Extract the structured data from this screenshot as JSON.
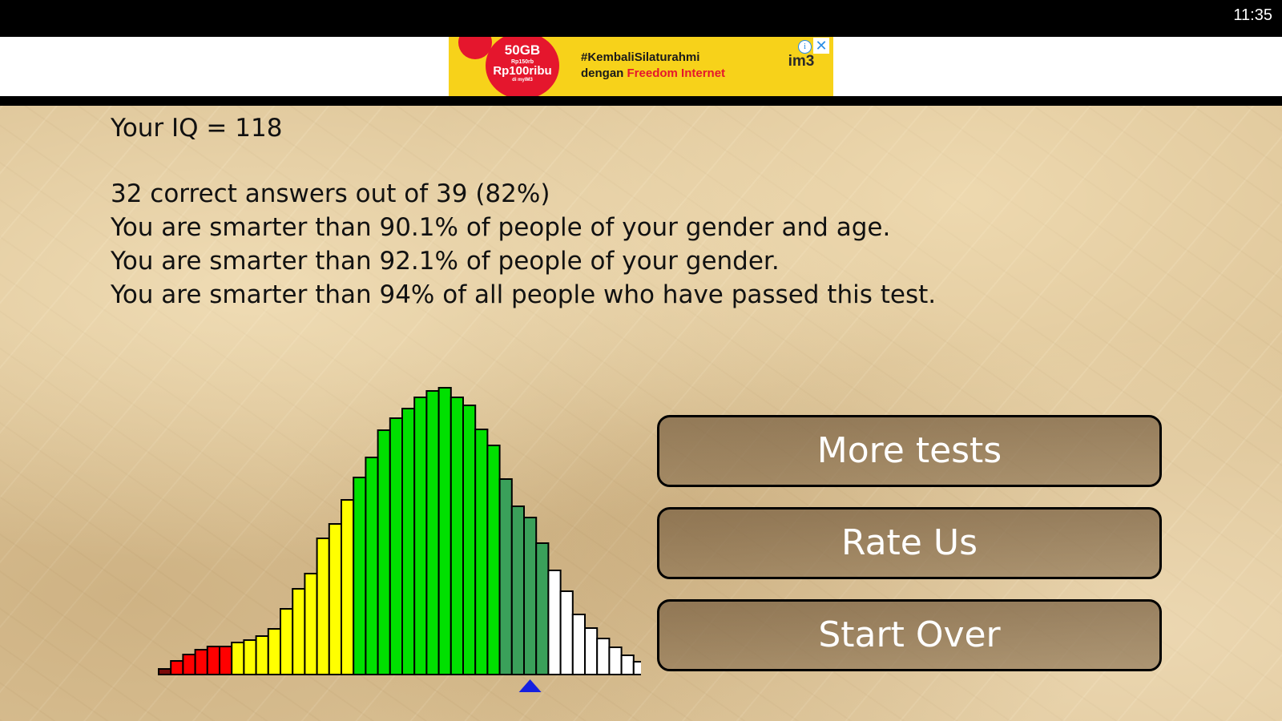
{
  "status_bar": {
    "time": "11:35"
  },
  "ad": {
    "data_amount": "50GB",
    "price_small": "Rp150rb",
    "price": "Rp100ribu",
    "price_sub": "di myIM3",
    "hashtag": "#KembaliSilaturahmi",
    "tagline_prefix": "dengan ",
    "tagline_highlight": "Freedom Internet",
    "brand": "im3",
    "info_icon": "info-icon",
    "close_icon": "close-icon",
    "colors": {
      "background": "#f7d21a",
      "accent": "#e5162d"
    }
  },
  "result": {
    "iq_line": "Your IQ = 118",
    "correct_line": "32 correct answers out of 39 (82%)",
    "gender_age_line": "You are smarter than 90.1% of people of your gender and age.",
    "gender_line": "You are smarter than 92.1% of people of your gender.",
    "all_line": "You are smarter than 94% of all people who have passed this test."
  },
  "chart_data": {
    "type": "bar",
    "marker_index": 30,
    "marker_color": "#1520e0",
    "values": [
      7,
      17,
      25,
      31,
      35,
      35,
      40,
      43,
      48,
      57,
      82,
      107,
      126,
      170,
      188,
      218,
      246,
      271,
      305,
      320,
      332,
      346,
      354,
      358,
      346,
      336,
      306,
      286,
      244,
      210,
      196,
      164,
      130,
      104,
      75,
      58,
      45,
      34,
      24,
      16
    ],
    "colors": [
      "#7a0a0a",
      "#ff0000",
      "#ff0000",
      "#ff0000",
      "#ff0000",
      "#ff0000",
      "#ffff00",
      "#ffff00",
      "#ffff00",
      "#ffff00",
      "#ffff00",
      "#ffff00",
      "#ffff00",
      "#ffff00",
      "#ffff00",
      "#ffff00",
      "#00e000",
      "#00e000",
      "#00e000",
      "#00e000",
      "#00e000",
      "#00e000",
      "#00e000",
      "#00e000",
      "#00e000",
      "#00e000",
      "#00e000",
      "#00e000",
      "#3aa05a",
      "#3aa05a",
      "#3aa05a",
      "#3aa05a",
      "#ffffff",
      "#ffffff",
      "#ffffff",
      "#ffffff",
      "#ffffff",
      "#ffffff",
      "#ffffff",
      "#ffffff"
    ]
  },
  "buttons": {
    "more_tests": "More tests",
    "rate_us": "Rate Us",
    "start_over": "Start Over"
  }
}
